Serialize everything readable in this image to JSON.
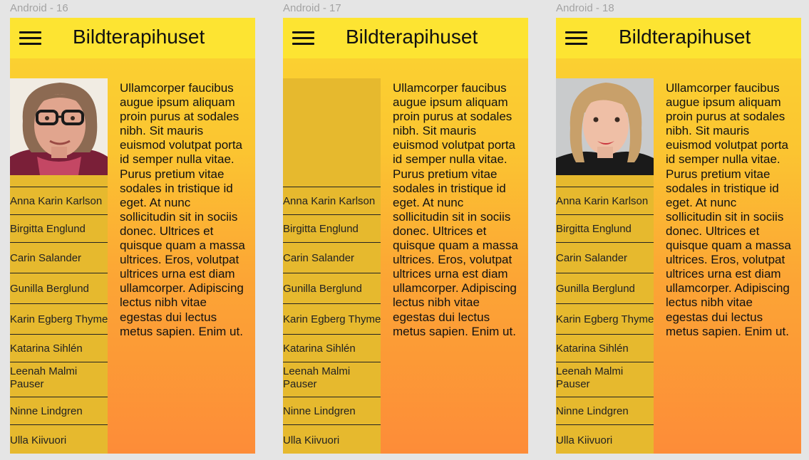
{
  "frames": [
    {
      "label": "Android - 16",
      "photo": "woman-glasses-photo"
    },
    {
      "label": "Android - 17",
      "photo": "empty-photo-placeholder"
    },
    {
      "label": "Android - 18",
      "photo": "blonde-woman-photo"
    }
  ],
  "app": {
    "title": "Bildterapihuset",
    "menu_icon": "hamburger-menu-icon"
  },
  "sidebar": {
    "names": [
      "Anna Karin Karlson",
      "Birgitta Englund",
      "Carin Salander",
      "Gunilla Berglund",
      "Karin Egberg Thyme",
      "Katarina Sihlén",
      "Leenah Malmi Pauser",
      "Ninne Lindgren",
      "Ulla Kiivuori"
    ]
  },
  "content": {
    "body": "Ullamcorper faucibus augue ipsum aliquam proin purus at sodales nibh. Sit mauris euismod volutpat porta id semper nulla vitae. Purus pretium vitae sodales in tristique id eget. At nunc sollicitudin sit in sociis donec. Ultrices et quisque quam a massa ultrices. Eros, volutpat ultrices urna est diam ullamcorper. Adipiscing lectus nibh vitae egestas dui lectus metus sapien. Enim ut."
  },
  "colors": {
    "background": "#e5e5e5",
    "appbar": "#fde432",
    "sidebar": "#e6b92e",
    "gradient_top": "#fbd531",
    "gradient_bottom": "#fd8c38"
  }
}
